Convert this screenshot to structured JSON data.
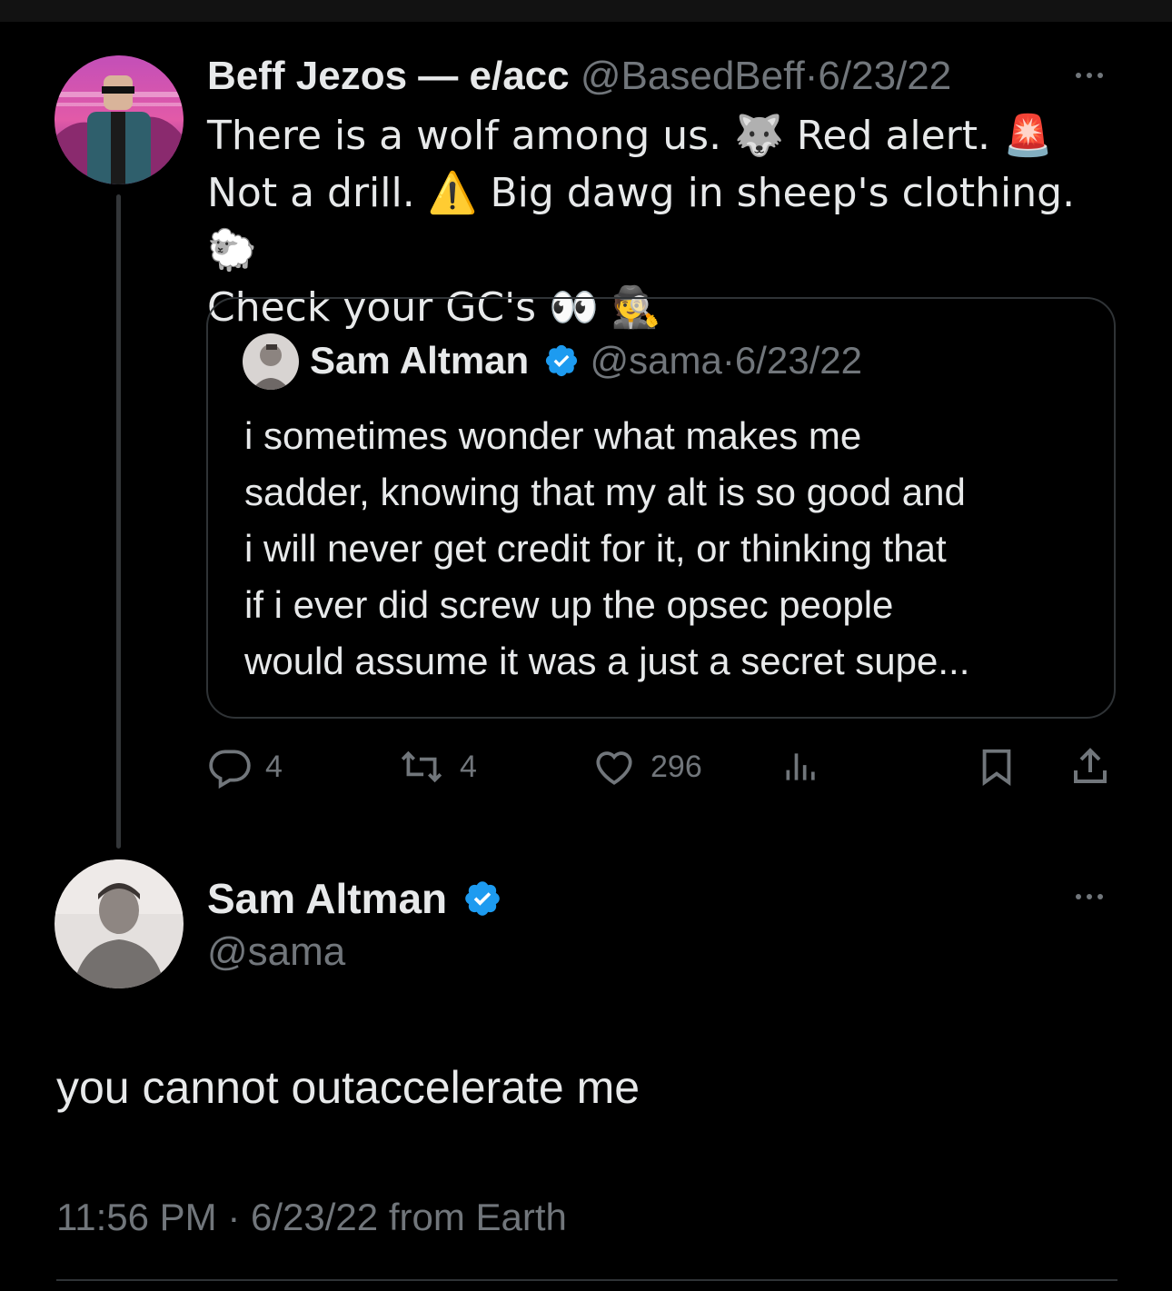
{
  "colors": {
    "background": "#000000",
    "text": "#e7e9ea",
    "muted": "#71767b",
    "border": "#2f3336",
    "verified": "#1d9bf0"
  },
  "quoting_tweet": {
    "author_name": "Beff Jezos — e/acc",
    "handle": "@BasedBeff",
    "separator": "·",
    "date": "6/23/22",
    "lines": [
      "There is a wolf among us. 🐺 Red alert. 🚨",
      "Not a drill. ⚠️ Big dawg in sheep's clothing. 🐑",
      "Check your GC's 👀 🕵️"
    ],
    "more_icon": "more-horizontal-icon"
  },
  "quoted_tweet": {
    "author_name": "Sam Altman",
    "verified_icon": "verified-badge-icon",
    "handle": "@sama",
    "separator": "·",
    "date": "6/23/22",
    "lines": [
      "i sometimes wonder what makes me",
      "sadder, knowing that my alt is so good and",
      "i will never get credit for it, or thinking that",
      "if i ever did screw up the opsec people",
      "would assume it was a just a secret supe..."
    ]
  },
  "actions": {
    "reply_count": "4",
    "retweet_count": "4",
    "like_count": "296"
  },
  "reply_tweet": {
    "author_name": "Sam Altman",
    "verified_icon": "verified-badge-icon",
    "handle": "@sama",
    "text": "you cannot outaccelerate me",
    "time": "11:56 PM",
    "separator": "·",
    "date": "6/23/22",
    "source": "from Earth",
    "more_icon": "more-horizontal-icon"
  }
}
